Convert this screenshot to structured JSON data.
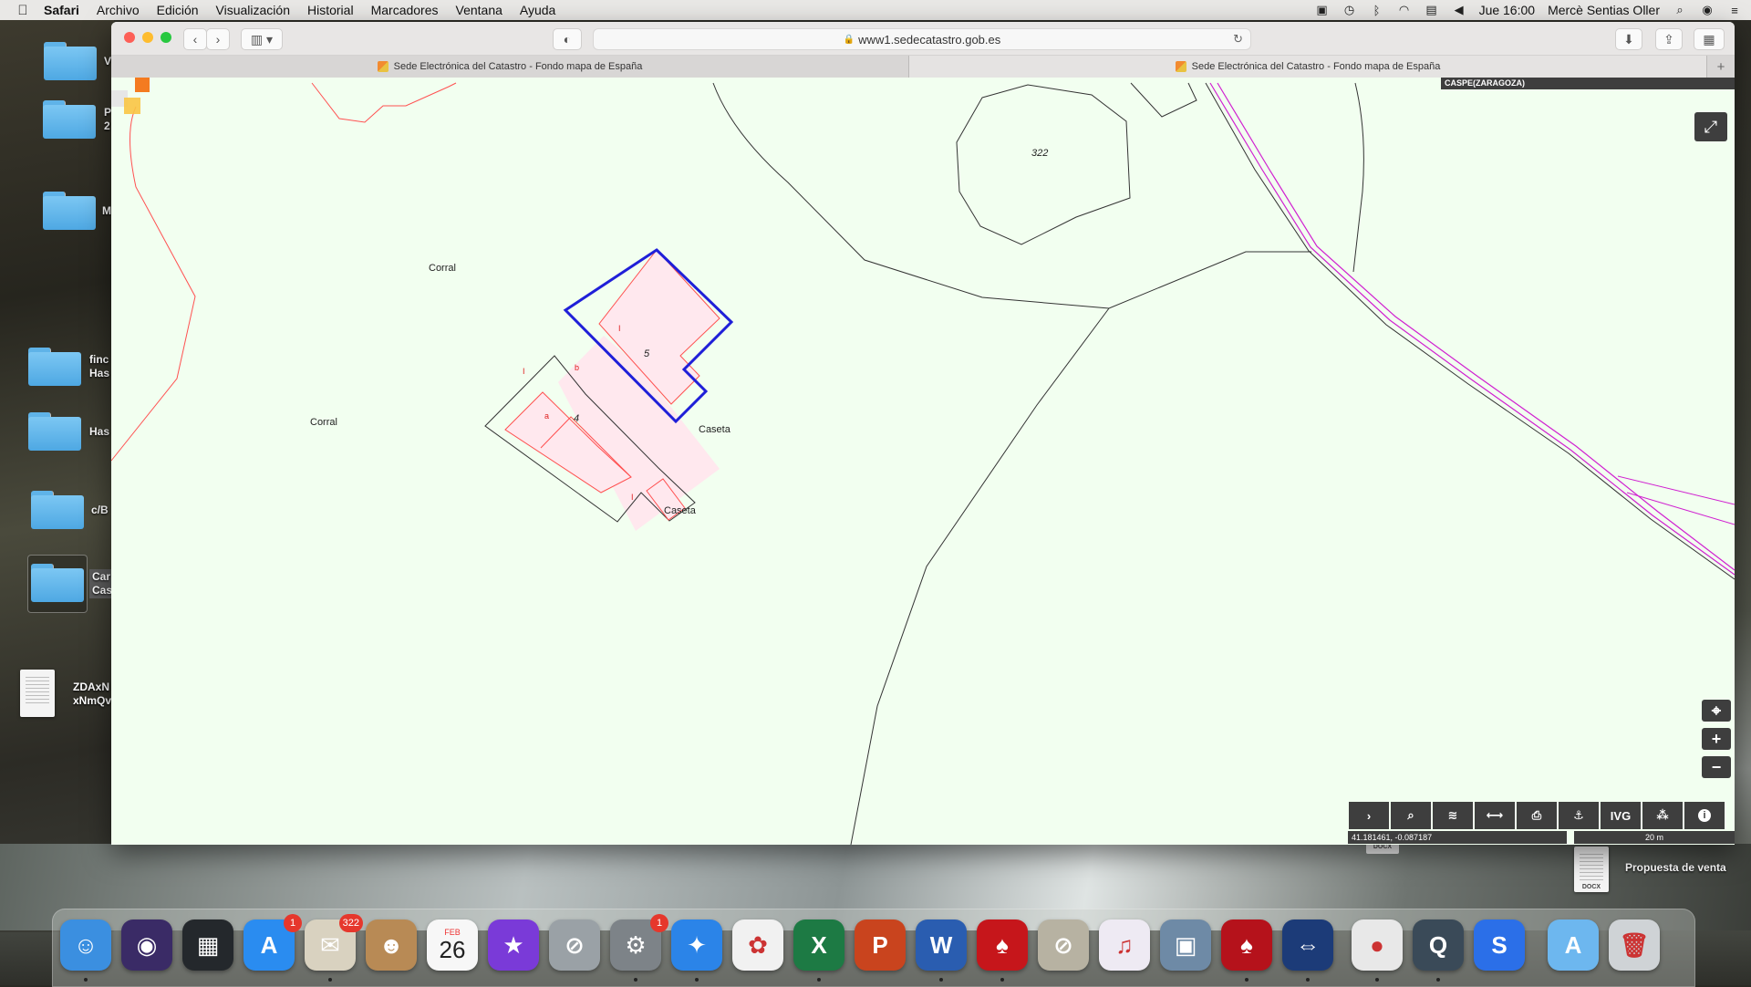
{
  "menubar": {
    "app": "Safari",
    "items": [
      "Archivo",
      "Edición",
      "Visualización",
      "Historial",
      "Marcadores",
      "Ventana",
      "Ayuda"
    ],
    "clock": "Jue 16:00",
    "user": "Mercè Sentias Oller"
  },
  "desktop": {
    "items": [
      {
        "label": "V",
        "icon": "folder-icon"
      },
      {
        "label": "P\n2",
        "icon": "folder-icon"
      },
      {
        "label": "M",
        "icon": "folder-icon"
      },
      {
        "label": "finc\nHas",
        "icon": "folder-icon"
      },
      {
        "label": "Has",
        "icon": "folder-icon"
      },
      {
        "label": "c/B",
        "icon": "folder-icon"
      },
      {
        "label": "Car\nCas",
        "icon": "folder-icon"
      },
      {
        "label": "ZDAxN\nxNmQv",
        "icon": "document-icon"
      }
    ],
    "docx_file": {
      "label": "Propuesta de venta",
      "ext": "DOCX"
    },
    "docx_small_ext": "DOCX"
  },
  "browser": {
    "url": "www1.sedecatastro.gob.es",
    "tabs": [
      {
        "title": "Sede Electrónica del Catastro - Fondo mapa de España",
        "active": false
      },
      {
        "title": "Sede Electrónica del Catastro - Fondo mapa de España",
        "active": true
      }
    ]
  },
  "map": {
    "municipality": "CASPE(ZARAGOZA)",
    "labels": {
      "corral_1": "Corral",
      "corral_2": "Corral",
      "caseta_1": "Caseta",
      "caseta_2": "Caseta",
      "parcel_322": "322",
      "parcel_5": "5",
      "parcel_4": "4",
      "sub_a": "a",
      "sub_b": "b",
      "sub_I1": "I",
      "sub_I2": "I",
      "sub_I3": "I"
    },
    "coordinates": "41.181461, -0.087187",
    "scale": "20 m",
    "tools": [
      {
        "name": "expand-tool",
        "label": "›"
      },
      {
        "name": "search-tool",
        "label": "⌕"
      },
      {
        "name": "layers-tool",
        "label": "≋"
      },
      {
        "name": "measure-tool",
        "label": "⟷"
      },
      {
        "name": "print-tool",
        "label": "⎙"
      },
      {
        "name": "location-tool",
        "label": "⚓"
      },
      {
        "name": "ivg-tool",
        "label": "IVG"
      },
      {
        "name": "share-tool",
        "label": "⁂"
      },
      {
        "name": "info-tool",
        "label": "i"
      }
    ],
    "zoom": {
      "locate": "⌖",
      "in": "+",
      "out": "−"
    }
  },
  "dock": {
    "apps": [
      {
        "name": "finder",
        "glyph": "☺",
        "color": "#3b8fe0"
      },
      {
        "name": "siri",
        "glyph": "◉",
        "color": "#3a2b66"
      },
      {
        "name": "photo-booth",
        "glyph": "▦",
        "color": "#24282c"
      },
      {
        "name": "app-store",
        "glyph": "A",
        "color": "#2a8cf0",
        "badge": "1"
      },
      {
        "name": "mail",
        "glyph": "✉",
        "color": "#d9d2c0",
        "badge": "322"
      },
      {
        "name": "contacts",
        "glyph": "☻",
        "color": "#b88a55"
      },
      {
        "name": "calendar",
        "glyph": "26",
        "color": "#f7f7f7",
        "month": "FEB"
      },
      {
        "name": "imovie",
        "glyph": "★",
        "color": "#7a3ad8"
      },
      {
        "name": "blocked-app-1",
        "glyph": "⊘",
        "color": "#9aa1a6"
      },
      {
        "name": "system-preferences",
        "glyph": "⚙",
        "color": "#7d8388",
        "badge": "1"
      },
      {
        "name": "safari",
        "glyph": "✦",
        "color": "#2b84e8"
      },
      {
        "name": "photos",
        "glyph": "✿",
        "color": "#f1f1f1"
      },
      {
        "name": "excel",
        "glyph": "X",
        "color": "#1d7a44"
      },
      {
        "name": "powerpoint",
        "glyph": "P",
        "color": "#c9441e"
      },
      {
        "name": "word",
        "glyph": "W",
        "color": "#2a5db0"
      },
      {
        "name": "acrobat-reader",
        "glyph": "♠",
        "color": "#c6161b"
      },
      {
        "name": "blocked-app-2",
        "glyph": "⊘",
        "color": "#b7b2a2"
      },
      {
        "name": "itunes",
        "glyph": "♫",
        "color": "#eeeaf3"
      },
      {
        "name": "preview",
        "glyph": "▣",
        "color": "#6e8aa6"
      },
      {
        "name": "acrobat-pro",
        "glyph": "♠",
        "color": "#b5121b"
      },
      {
        "name": "teamviewer",
        "glyph": "⇔",
        "color": "#1c3b78"
      },
      {
        "name": "chrome",
        "glyph": "●",
        "color": "#e8e8e8"
      },
      {
        "name": "quicktime",
        "glyph": "Q",
        "color": "#3a4a58"
      },
      {
        "name": "shazam",
        "glyph": "S",
        "color": "#2b6fe8"
      },
      {
        "name": "applications-folder",
        "glyph": "A",
        "color": "#6db7ef"
      },
      {
        "name": "trash",
        "glyph": "🗑",
        "color": "#cfd3d6"
      }
    ]
  }
}
